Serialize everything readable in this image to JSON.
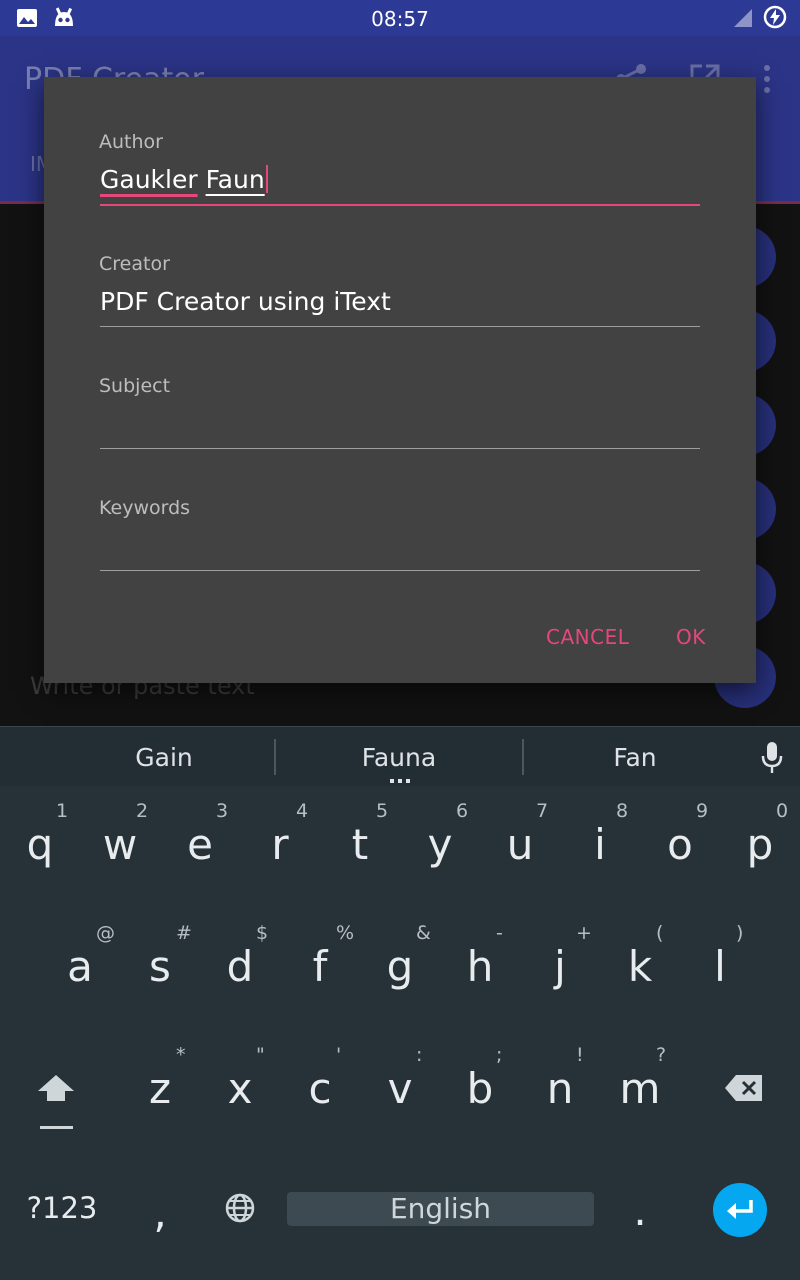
{
  "status_bar": {
    "time": "08:57"
  },
  "background_app": {
    "title": "PDF Creator",
    "tab_fragment": "IM",
    "editor_placeholder": "Write or paste text"
  },
  "dialog": {
    "fields": [
      {
        "label": "Author",
        "value_word1": "Gaukler",
        "value_word2": "Faun"
      },
      {
        "label": "Creator",
        "value": "PDF Creator using iText"
      },
      {
        "label": "Subject",
        "value": ""
      },
      {
        "label": "Keywords",
        "value": ""
      }
    ],
    "cancel_label": "CANCEL",
    "ok_label": "OK"
  },
  "keyboard": {
    "suggestions": [
      "Gain",
      "Fauna",
      "Fan"
    ],
    "row1": [
      {
        "key": "q",
        "sup": "1"
      },
      {
        "key": "w",
        "sup": "2"
      },
      {
        "key": "e",
        "sup": "3"
      },
      {
        "key": "r",
        "sup": "4"
      },
      {
        "key": "t",
        "sup": "5"
      },
      {
        "key": "y",
        "sup": "6"
      },
      {
        "key": "u",
        "sup": "7"
      },
      {
        "key": "i",
        "sup": "8"
      },
      {
        "key": "o",
        "sup": "9"
      },
      {
        "key": "p",
        "sup": "0"
      }
    ],
    "row2": [
      {
        "key": "a",
        "sup": "@"
      },
      {
        "key": "s",
        "sup": "#"
      },
      {
        "key": "d",
        "sup": "$"
      },
      {
        "key": "f",
        "sup": "%"
      },
      {
        "key": "g",
        "sup": "&"
      },
      {
        "key": "h",
        "sup": "-"
      },
      {
        "key": "j",
        "sup": "+"
      },
      {
        "key": "k",
        "sup": "("
      },
      {
        "key": "l",
        "sup": ")"
      }
    ],
    "row3": [
      {
        "key": "z",
        "sup": "*"
      },
      {
        "key": "x",
        "sup": "\""
      },
      {
        "key": "c",
        "sup": "'"
      },
      {
        "key": "v",
        "sup": ":"
      },
      {
        "key": "b",
        "sup": ";"
      },
      {
        "key": "n",
        "sup": "!"
      },
      {
        "key": "m",
        "sup": "?"
      }
    ],
    "symbols_key": "?123",
    "comma_key": ",",
    "space_label": "English",
    "period_key": "."
  },
  "colors": {
    "accent": "#e5477a",
    "primary": "#3f51b5",
    "enter_key": "#04a7f0"
  }
}
